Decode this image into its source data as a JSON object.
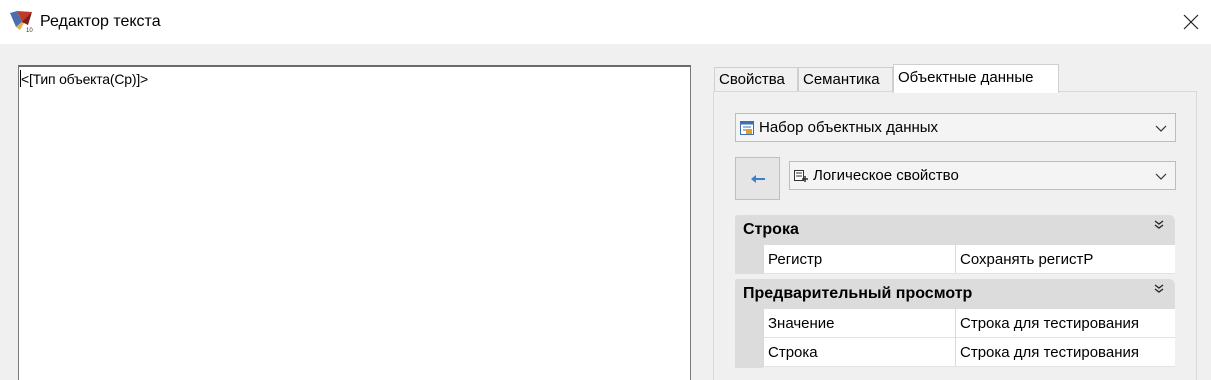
{
  "window": {
    "title": "Редактор текста",
    "app_icon": "gis-map-icon",
    "close_icon": "close-icon"
  },
  "editor": {
    "content": "<[Тип объекта(Ср)]>"
  },
  "tabs": [
    {
      "label": "Свойства",
      "active": false
    },
    {
      "label": "Семантика",
      "active": false
    },
    {
      "label": "Объектные данные",
      "active": true
    }
  ],
  "panel": {
    "dataset_combo": {
      "value": "Набор объектных данных",
      "icon": "table-icon"
    },
    "property_combo": {
      "value": "Логическое свойство",
      "icon": "add-property-icon"
    },
    "back_button_icon": "arrow-left-icon"
  },
  "property_grid": {
    "categories": [
      {
        "label": "Строка",
        "rows": [
          {
            "name": "Регистр",
            "value": "Сохранять регистР"
          }
        ]
      },
      {
        "label": "Предварительный просмотр",
        "rows": [
          {
            "name": "Значение",
            "value": "Строка для тестирования"
          },
          {
            "name": "Строка",
            "value": "Строка для тестирования"
          }
        ]
      }
    ]
  },
  "colors": {
    "accent_arrow": "#3d7ec9",
    "category_bg": "#dcdcdc",
    "window_bg": "#f0f0f0"
  }
}
